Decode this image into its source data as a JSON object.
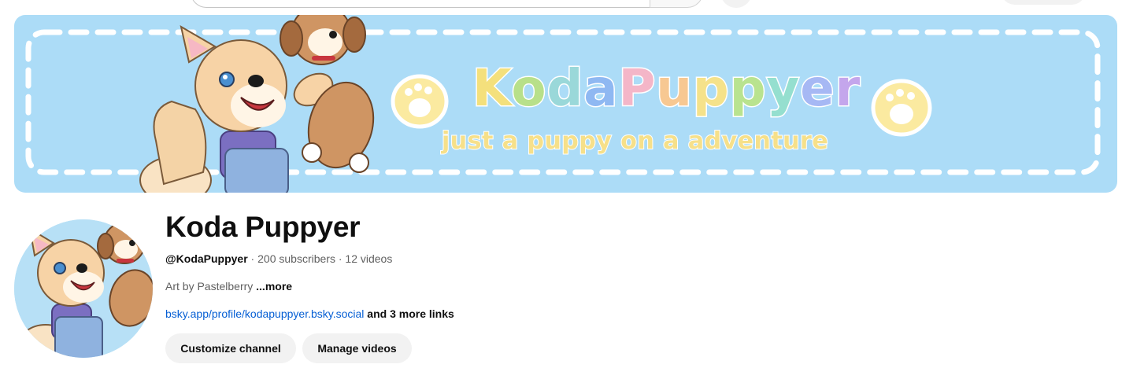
{
  "header": {
    "search_placeholder": ""
  },
  "banner": {
    "title_letters": [
      "K",
      "o",
      "d",
      "a",
      "P",
      "u",
      "p",
      "p",
      "y",
      "e",
      "r"
    ],
    "title_colors": [
      "#f4e07c",
      "#b8e08a",
      "#9ad8d9",
      "#8fb8f2",
      "#f4b6c8",
      "#f7c892",
      "#f5e28a",
      "#b9e38f",
      "#95dfcf",
      "#a6b8f4",
      "#c4a6ec"
    ],
    "subtitle": "just a puppy on a adventure",
    "subtitle_color": "#f6e08a",
    "background_color": "#acdcf7"
  },
  "channel": {
    "name": "Koda Puppyer",
    "handle": "@KodaPuppyer",
    "subscribers": "200 subscribers",
    "videos": "12 videos",
    "separator": " · ",
    "description": "Art by Pastelberry",
    "description_more": "...more",
    "primary_link": "bsky.app/profile/kodapuppyer.bsky.social",
    "more_links": "and 3 more links"
  },
  "actions": {
    "customize_label": "Customize channel",
    "manage_label": "Manage videos"
  },
  "colors": {
    "link": "#065fd4",
    "secondary_text": "#606060",
    "button_bg": "#f2f2f2"
  }
}
